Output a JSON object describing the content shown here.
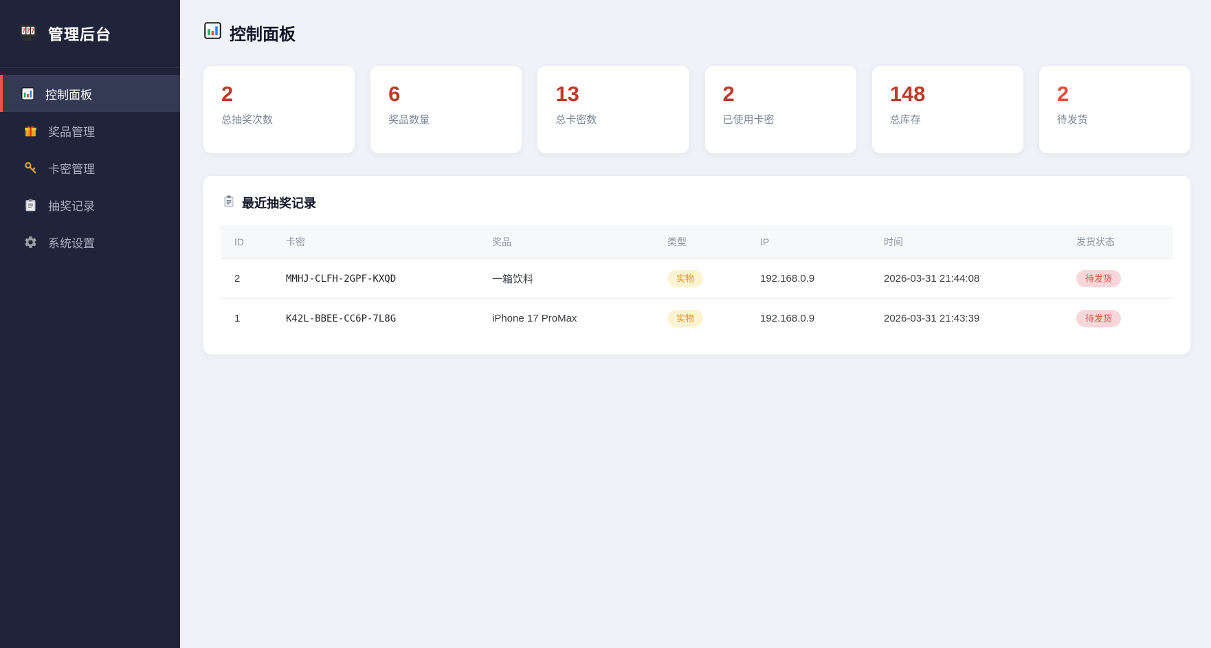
{
  "app": {
    "title": "管理后台",
    "logo_icon": "slot-machine-icon"
  },
  "sidebar": {
    "items": [
      {
        "icon": "bar-chart-icon",
        "label": "控制面板",
        "active": true
      },
      {
        "icon": "gift-icon",
        "label": "奖品管理",
        "active": false
      },
      {
        "icon": "key-icon",
        "label": "卡密管理",
        "active": false
      },
      {
        "icon": "clipboard-icon",
        "label": "抽奖记录",
        "active": false
      },
      {
        "icon": "gear-icon",
        "label": "系统设置",
        "active": false
      }
    ]
  },
  "header": {
    "icon": "bar-chart-icon",
    "title": "控制面板"
  },
  "stats": [
    {
      "value": "2",
      "label": "总抽奖次数",
      "color": "#c0392b"
    },
    {
      "value": "6",
      "label": "奖品数量",
      "color": "#c0392b"
    },
    {
      "value": "13",
      "label": "总卡密数",
      "color": "#c0392b"
    },
    {
      "value": "2",
      "label": "已使用卡密",
      "color": "#c0392b"
    },
    {
      "value": "148",
      "label": "总库存",
      "color": "#c0392b"
    },
    {
      "value": "2",
      "label": "待发货",
      "color": "#e74c3c"
    }
  ],
  "records": {
    "icon": "clipboard-icon",
    "title": "最近抽奖记录",
    "columns": {
      "id": "ID",
      "key": "卡密",
      "prize": "奖品",
      "type": "类型",
      "ip": "IP",
      "time": "时间",
      "status": "发货状态"
    },
    "rows": [
      {
        "id": "2",
        "key": "MMHJ-CLFH-2GPF-KXQD",
        "prize": "一箱饮料",
        "type": "实物",
        "ip": "192.168.0.9",
        "time": "2026-03-31 21:44:08",
        "status": "待发货"
      },
      {
        "id": "1",
        "key": "K42L-BBEE-CC6P-7L8G",
        "prize": "iPhone 17 ProMax",
        "type": "实物",
        "ip": "192.168.0.9",
        "time": "2026-03-31 21:43:39",
        "status": "待发货"
      }
    ]
  },
  "colors": {
    "sidebar_bg": "#20243a",
    "sidebar_active_bg": "#343a54",
    "sidebar_active_border": "#e8544a",
    "main_bg": "#f1f2f7",
    "stat_number_red": "#c0392b",
    "stat_number_orange": "#e74c3c",
    "type_badge_bg": "#fcf3d2",
    "type_badge_text": "#e2931d",
    "status_badge_bg": "#f8d7da",
    "status_badge_text": "#e05252"
  }
}
